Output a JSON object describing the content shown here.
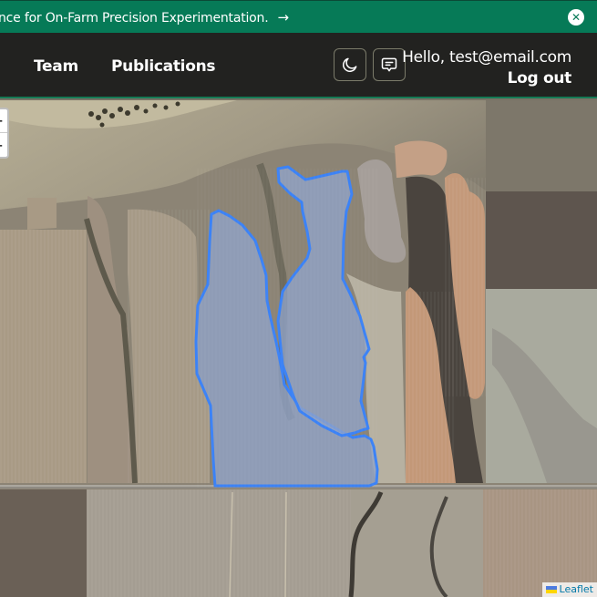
{
  "banner": {
    "text": "nce for On-Farm Precision Experimentation.",
    "arrow_icon": "arrow-right-icon",
    "close_icon": "close-circle-icon",
    "background": "#067a57"
  },
  "header": {
    "nav": [
      {
        "label": "Team"
      },
      {
        "label": "Publications"
      }
    ],
    "theme_toggle_icon": "moon-icon",
    "feedback_icon": "chat-icon",
    "greeting": "Hello, test@email.com",
    "logout_label": "Log out",
    "background": "#222220",
    "border_accent": "#157a55"
  },
  "map": {
    "zoom_in_label": "+",
    "zoom_out_label": "−",
    "attribution_label": "Leaflet",
    "attribution_icon": "ukraine-flag-icon",
    "field_outline_color": "#3b82f6",
    "field_fill_color": "#8fa3c8",
    "fields": [
      {
        "name": "field-boundary-west"
      },
      {
        "name": "field-boundary-east"
      }
    ]
  }
}
